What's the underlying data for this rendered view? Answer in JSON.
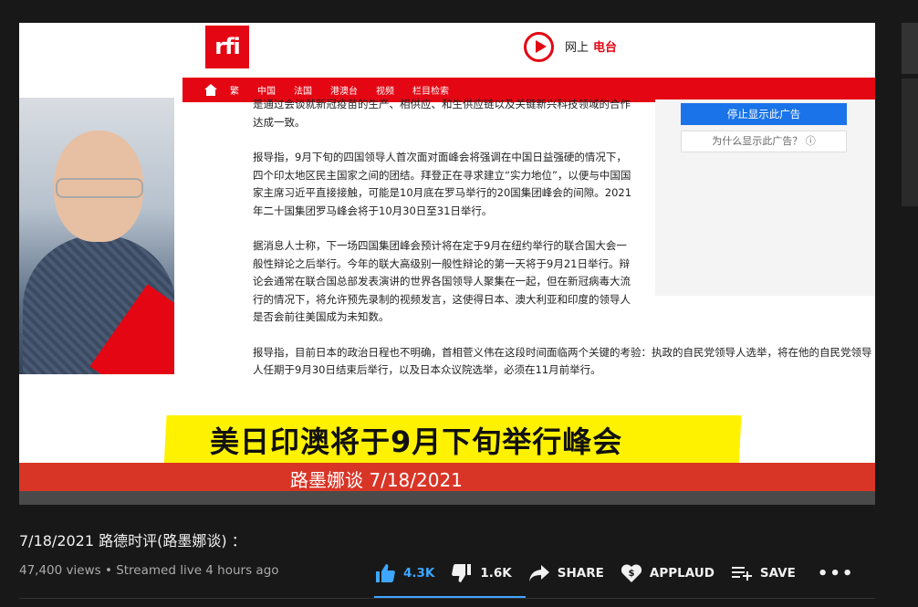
{
  "video": {
    "rfi_logo": "rfi",
    "live_net": "网上",
    "live_radio": "电台",
    "nav": [
      "繁",
      "中国",
      "法国",
      "港澳台",
      "视频",
      "栏目检索"
    ],
    "article": [
      "是通过会谈就新冠疫苗的生产、相供应、和生供应链以及关键新兴科技领域的合作达成一致。",
      "报导指，9月下旬的四国领导人首次面对面峰会将强调在中国日益强硬的情况下，四个印太地区民主国家之间的团结。拜登正在寻求建立“实力地位”，以便与中国国家主席习近平直接接触，可能是10月底在罗马举行的20国集团峰会的间隙。2021年二十国集团罗马峰会将于10月30日至31日举行。",
      "据消息人士称，下一场四国集团峰会预计将在定于9月在纽约举行的联合国大会一般性辩论之后举行。今年的联大高级别一般性辩论的第一天将于9月21日举行。辩论会通常在联合国总部发表演讲的世界各国领导人聚集在一起，但在新冠病毒大流行的情况下，将允许预先录制的视频发言，这使得日本、澳大利亚和印度的领导人是否会前往美国成为未知数。",
      "报导指，目前日本的政治日程也不明确，首相菅义伟在这段时间面临两个关键的考验：执政的自民党领导人选举，将在他的自民党领导人任期于9月30日结束后举行，以及日本众议院选举，必须在11月前举行。"
    ],
    "ad_stop": "停止显示此广告",
    "ad_why": "为什么显示此广告？ ⓘ",
    "headline": "美日印澳将于9月下旬举行峰会",
    "subtitle": "路墨娜谈 7/18/2021"
  },
  "info": {
    "title": "7/18/2021 路德时评(路墨娜谈) ：",
    "meta": "47,400 views • Streamed live 4 hours ago",
    "likes": "4.3K",
    "dislikes": "1.6K",
    "share": "SHARE",
    "applaud": "APPLAUD",
    "save": "SAVE",
    "more": "•••"
  },
  "colors": {
    "background": "#181818",
    "accent": "#3ea6ff",
    "rfi_red": "#e40613",
    "highlight": "#fff200"
  }
}
